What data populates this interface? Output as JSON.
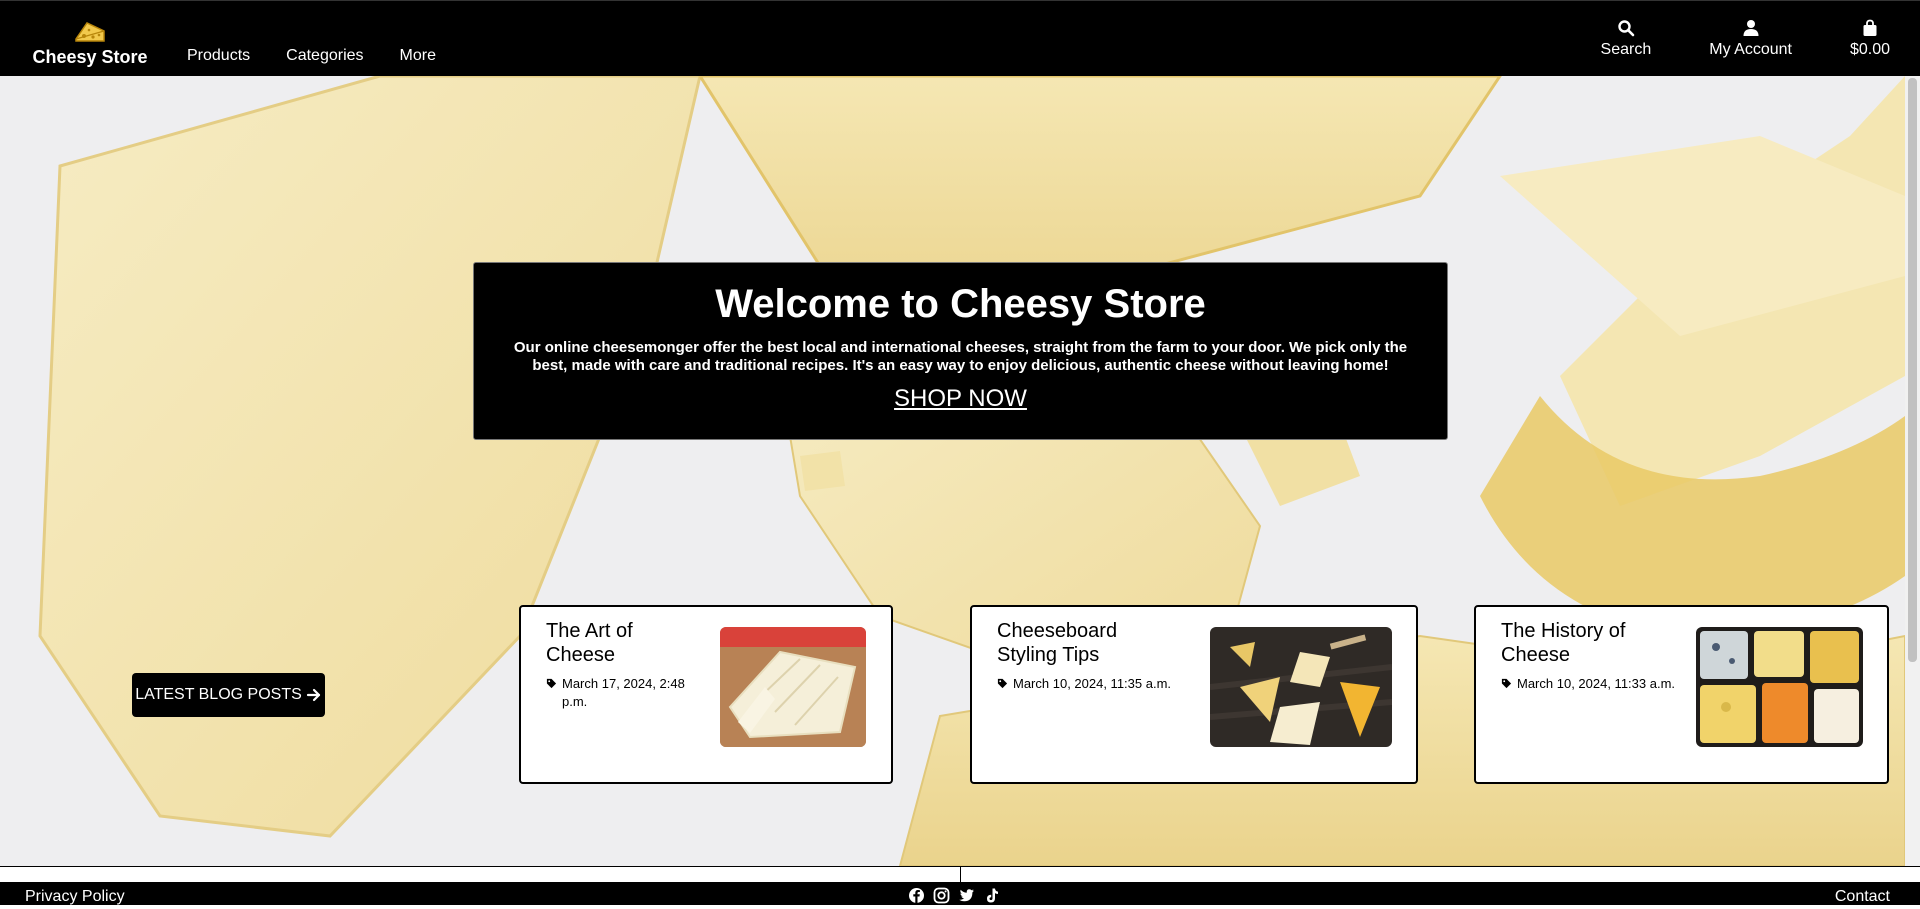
{
  "brand": {
    "name": "Cheesy Store",
    "logo_icon": "cheese-wedge-icon"
  },
  "nav": {
    "links": [
      {
        "label": "Products"
      },
      {
        "label": "Categories"
      },
      {
        "label": "More"
      }
    ],
    "actions": [
      {
        "label": "Search",
        "icon": "search-icon"
      },
      {
        "label": "My Account",
        "icon": "user-icon"
      },
      {
        "label": "$0.00",
        "icon": "shopping-bag-icon"
      }
    ]
  },
  "hero": {
    "title": "Welcome to Cheesy Store",
    "description": "Our online cheesemonger offer the best local and international cheeses, straight from the farm to your door. We pick only the best, made with care and traditional recipes. It's an easy way to enjoy delicious, authentic cheese without leaving home!",
    "cta": "SHOP NOW"
  },
  "blog": {
    "button_label": "LATEST BLOG POSTS",
    "posts": [
      {
        "title": "The Art of Cheese",
        "date": "March 17, 2024, 2:48 p.m."
      },
      {
        "title": "Cheeseboard Styling Tips",
        "date": "March 10, 2024, 11:35 a.m."
      },
      {
        "title": "The History of Cheese",
        "date": "March 10, 2024, 11:33 a.m."
      }
    ]
  },
  "footer": {
    "privacy": "Privacy Policy",
    "contact": "Contact",
    "socials": [
      "facebook-icon",
      "instagram-icon",
      "twitter-icon",
      "tiktok-icon"
    ]
  },
  "colors": {
    "nav_bg": "#000000",
    "accent_text": "#ffffff",
    "cheese_light": "#f3e6b4",
    "cheese_rind": "#e2c46a"
  }
}
